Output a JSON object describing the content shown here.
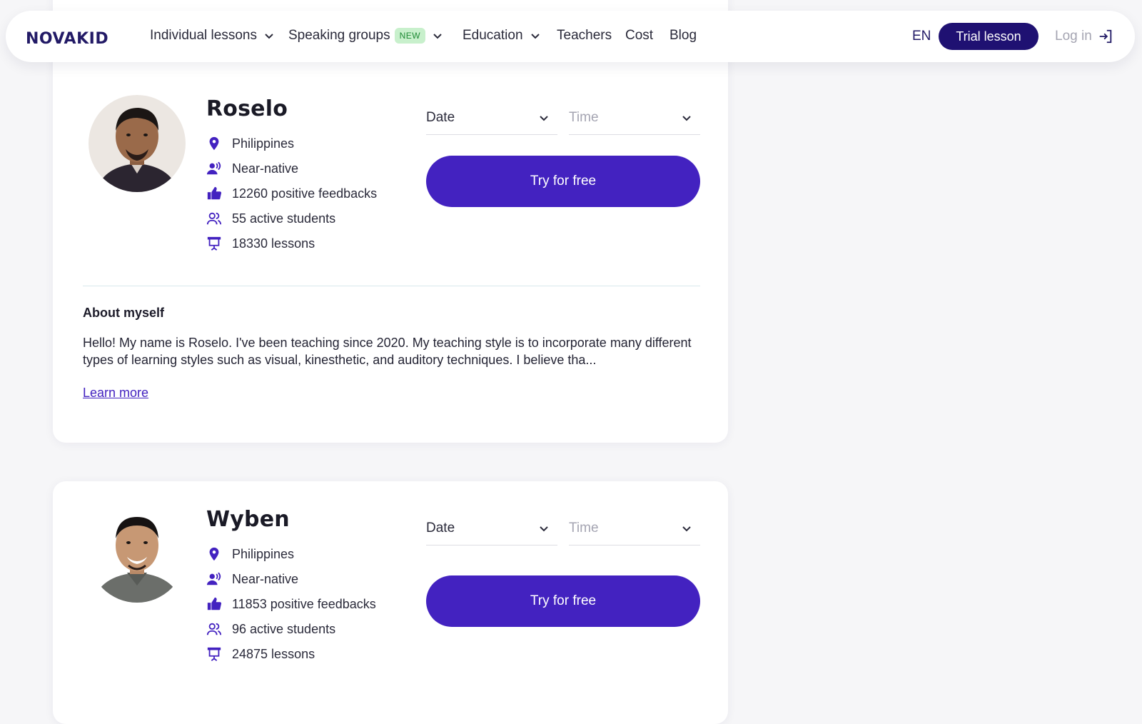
{
  "header": {
    "logo_text": "NOVAKID",
    "nav": [
      {
        "label": "Individual lessons",
        "has_dropdown": true
      },
      {
        "label": "Speaking groups",
        "badge": "NEW",
        "has_dropdown": true
      },
      {
        "label": "Education",
        "has_dropdown": true
      },
      {
        "label": "Teachers"
      },
      {
        "label": "Cost"
      },
      {
        "label": "Blog"
      }
    ],
    "language": "EN",
    "trial_label": "Trial lesson",
    "login_label": "Log in"
  },
  "teachers": [
    {
      "name": "Roselo",
      "country": "Philippines",
      "level": "Near-native",
      "feedbacks": "12260 positive feedbacks",
      "students": "55 active students",
      "lessons": "18330 lessons",
      "date_label": "Date",
      "time_label": "Time",
      "cta": "Try for free",
      "about_title": "About myself",
      "about_text": "Hello! My name is Roselo. I've been teaching since 2020. My teaching style is to incorporate many different types of learning styles such as visual, kinesthetic, and auditory techniques. I believe tha...",
      "learn_more": "Learn more"
    },
    {
      "name": "Wyben",
      "country": "Philippines",
      "level": "Near-native",
      "feedbacks": "11853 positive feedbacks",
      "students": "96 active students",
      "lessons": "24875 lessons",
      "date_label": "Date",
      "time_label": "Time",
      "cta": "Try for free"
    }
  ],
  "colors": {
    "primary": "#4322c0",
    "navy": "#1f1172",
    "badge_bg": "#c8f0cc",
    "badge_text": "#1f8a35",
    "icon": "#4322c0"
  },
  "icons": [
    "location-pin-icon",
    "speaking-person-icon",
    "thumbs-up-icon",
    "users-icon",
    "presentation-board-icon",
    "chevron-down-icon",
    "login-arrow-icon"
  ]
}
